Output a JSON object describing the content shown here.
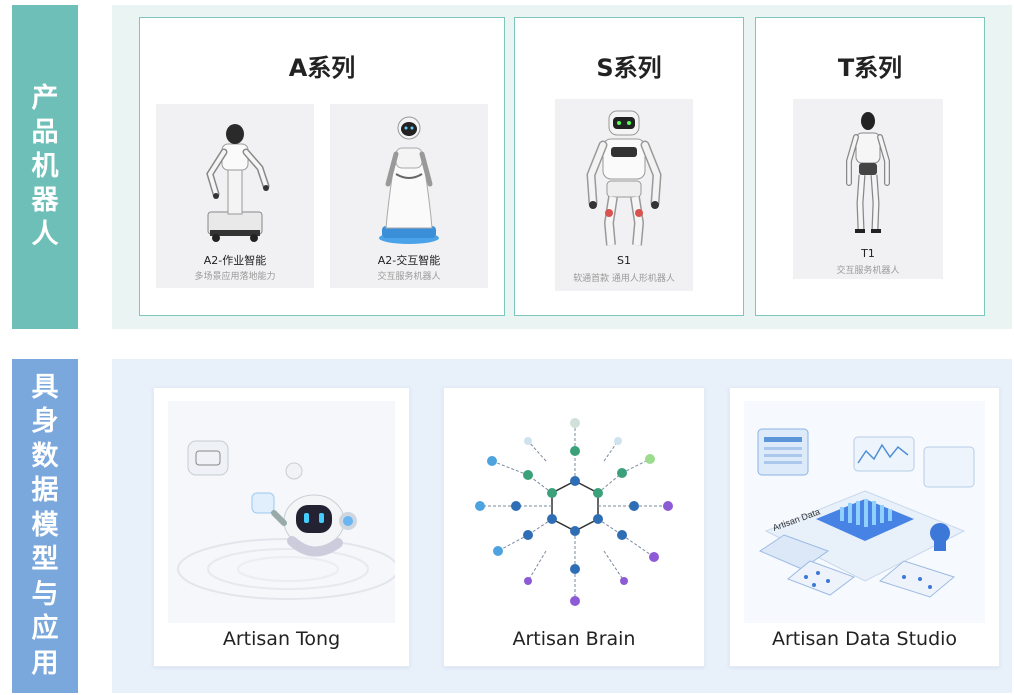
{
  "side_labels": {
    "top": [
      "产",
      "品",
      "机",
      "器",
      "人"
    ],
    "bottom": [
      "具",
      "身",
      "数",
      "据",
      "模",
      "型",
      "与",
      "应",
      "用"
    ]
  },
  "series": [
    {
      "title": "A系列",
      "robots": [
        {
          "name": "A2-作业智能",
          "desc": "多场景应用落地能力",
          "icon": "industrial-arm-robot"
        },
        {
          "name": "A2-交互智能",
          "desc": "交互服务机器人",
          "icon": "service-robot"
        }
      ]
    },
    {
      "title": "S系列",
      "robots": [
        {
          "name": "S1",
          "desc": "软通首款 通用人形机器人",
          "icon": "humanoid-robot"
        }
      ]
    },
    {
      "title": "T系列",
      "robots": [
        {
          "name": "T1",
          "desc": "交互服务机器人",
          "icon": "humanoid-robot-slim"
        }
      ]
    }
  ],
  "platforms": [
    {
      "name": "Artisan Tong",
      "icon": "chat-bot-illustration"
    },
    {
      "name": "Artisan Brain",
      "icon": "hexagon-network-illustration"
    },
    {
      "name": "Artisan Data Studio",
      "icon": "data-platform-illustration",
      "image_text": "Artisan Data"
    }
  ],
  "colors": {
    "top_accent": "#6dbfb8",
    "bottom_accent": "#7aa8dc",
    "top_bg": "#e9f4f3",
    "bottom_bg": "#e8f1fa",
    "box_border": "#7cc6be"
  }
}
